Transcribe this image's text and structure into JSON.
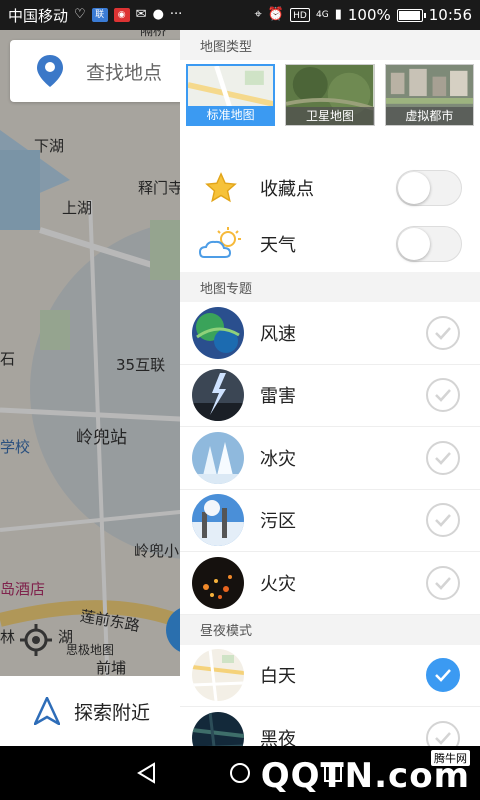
{
  "status_bar": {
    "carrier": "中国移动",
    "hd_badge": "HD",
    "network": "4G",
    "battery_percent": "100%",
    "time": "10:56",
    "left_icons": [
      "heart-icon",
      "app-badge-icon",
      "app-badge-icon",
      "mail-icon",
      "location-pin-icon",
      "more-icon"
    ],
    "right_icons": [
      "location-icon",
      "alarm-icon",
      "signal-icon",
      "battery-icon"
    ]
  },
  "map": {
    "search_placeholder": "查找地点",
    "labels": {
      "xiahu": "下湖",
      "shi_men_si": "释门寺",
      "shanghu": "上湖",
      "hulian": "35互联",
      "xuexiao": "学校",
      "lingdou_zhan": "岭兜站",
      "lingdou_xiao": "岭兜小",
      "jiudian": "岛酒店",
      "lianqian_donglu": "莲前东路",
      "siji_ditu": "思极地图",
      "qianpu": "前埔",
      "lin": "林",
      "hu": "湖",
      "shi_label": "石",
      "top_label": "隔桥"
    },
    "explore_nearby": "探索附近"
  },
  "panel": {
    "map_type_header": "地图类型",
    "map_types": [
      {
        "label": "标准地图",
        "selected": true
      },
      {
        "label": "卫星地图",
        "selected": false
      },
      {
        "label": "虚拟都市",
        "selected": false
      }
    ],
    "toggles": [
      {
        "label": "收藏点",
        "icon": "star-icon",
        "on": false
      },
      {
        "label": "天气",
        "icon": "weather-icon",
        "on": false
      }
    ],
    "topic_header": "地图专题",
    "topics": [
      {
        "label": "风速",
        "checked": false
      },
      {
        "label": "雷害",
        "checked": false
      },
      {
        "label": "冰灾",
        "checked": false
      },
      {
        "label": "污区",
        "checked": false
      },
      {
        "label": "火灾",
        "checked": false
      }
    ],
    "daynight_header": "昼夜模式",
    "daynight": [
      {
        "label": "白天",
        "checked": true
      },
      {
        "label": "黑夜",
        "checked": false
      }
    ]
  },
  "watermark": {
    "text": "QQTN.com",
    "sub": "腾牛网"
  },
  "colors": {
    "accent": "#3b9af2",
    "panel_header_bg": "#f3f3f3",
    "status_bar_bg": "#1a1a1a"
  }
}
